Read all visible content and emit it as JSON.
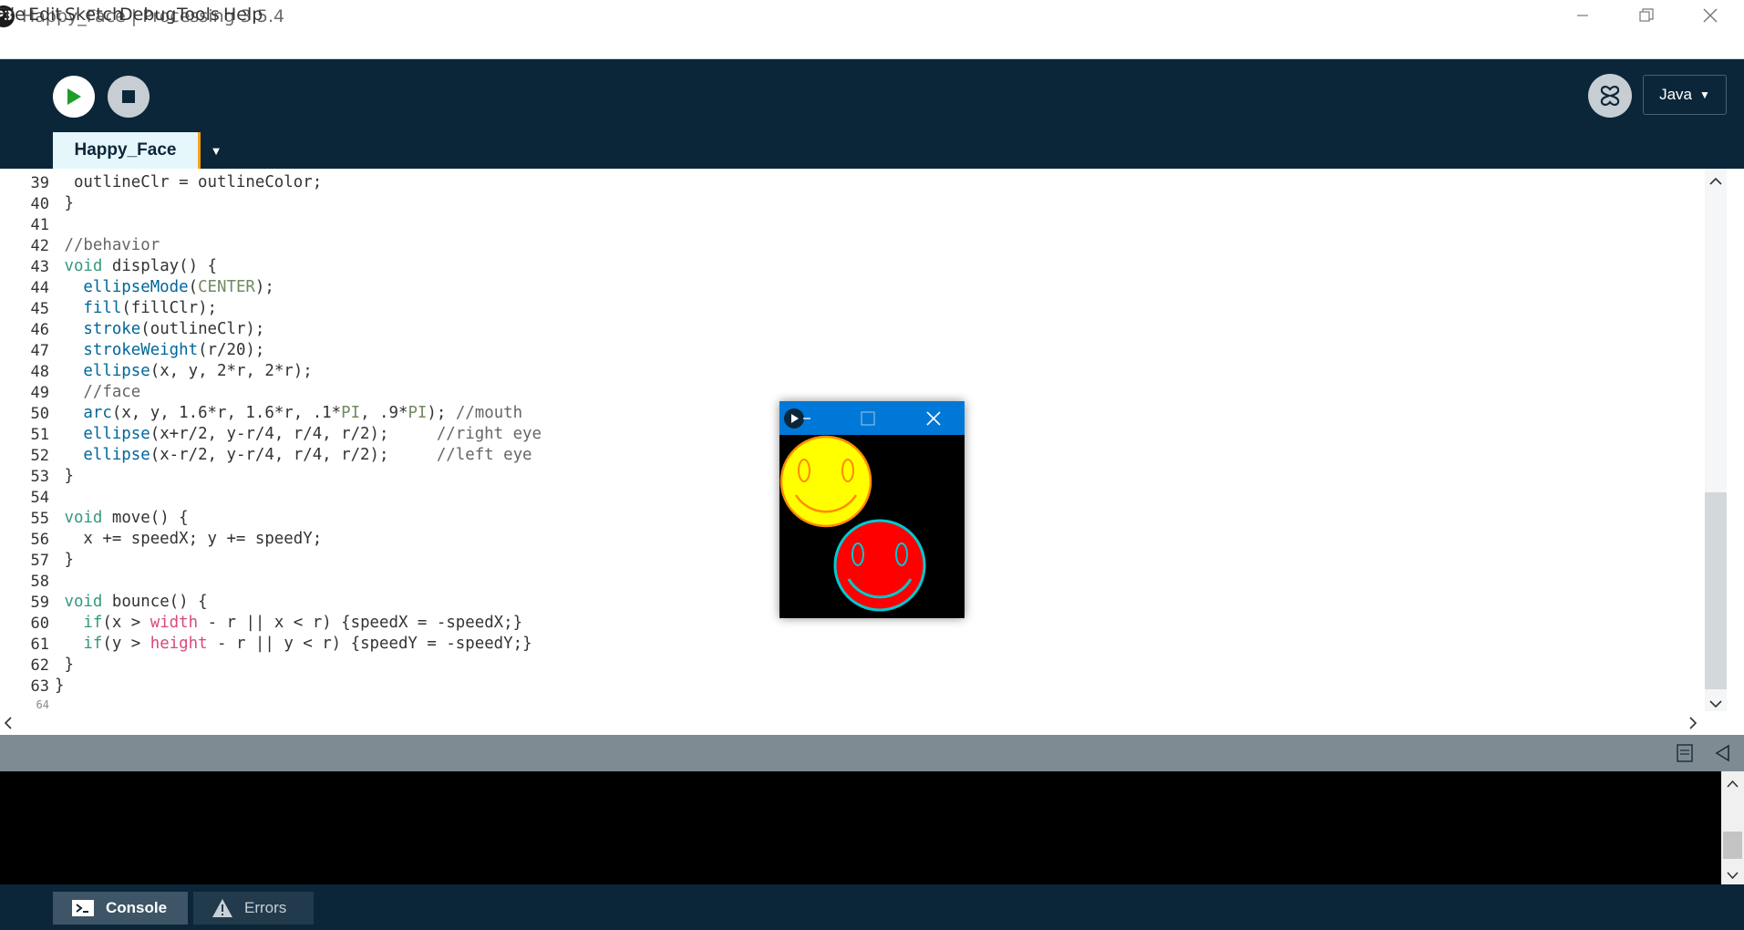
{
  "window": {
    "title": "Happy_Face | Processing 3.5.4",
    "logo": "P3"
  },
  "menu": {
    "file": "File",
    "edit": "Edit",
    "sketch": "Sketch",
    "debug": "Debug",
    "tools": "Tools",
    "help": "Help"
  },
  "toolbar": {
    "mode": "Java",
    "mode_arrow": "▼"
  },
  "tab": {
    "name": "Happy_Face",
    "menu_arrow": "▼"
  },
  "editor": {
    "line_numbers": [
      "39",
      "40",
      "41",
      "42",
      "43",
      "44",
      "45",
      "46",
      "47",
      "48",
      "49",
      "50",
      "51",
      "52",
      "53",
      "54",
      "55",
      "56",
      "57",
      "58",
      "59",
      "60",
      "61",
      "62",
      "63",
      "64"
    ]
  },
  "footer": {
    "console": "Console",
    "errors": "Errors"
  },
  "sketch": {
    "faces": [
      {
        "fill": "#ffff00",
        "outline": "#ff8c00"
      },
      {
        "fill": "#ff0000",
        "outline": "#00c8d2"
      }
    ]
  }
}
